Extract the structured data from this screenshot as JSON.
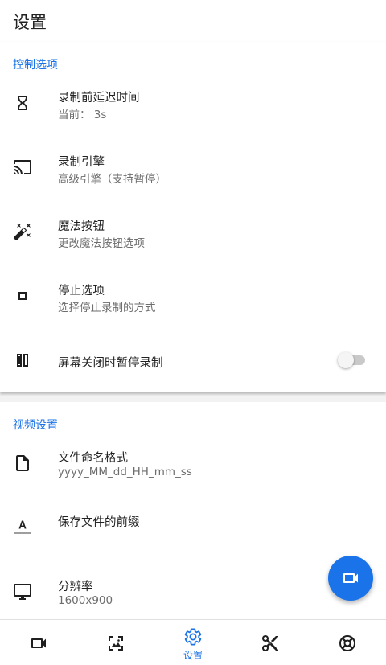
{
  "header": {
    "title": "设置"
  },
  "control_section": {
    "title": "控制选项",
    "items": [
      {
        "label": "录制前延迟时间",
        "subtitle": "当前： 3s",
        "icon": "hourglass-icon"
      },
      {
        "label": "录制引擎",
        "subtitle": "高级引擎（支持暂停）",
        "icon": "cast-icon"
      },
      {
        "label": "魔法按钮",
        "subtitle": "更改魔法按钮选项",
        "icon": "magic-wand-icon"
      },
      {
        "label": "停止选项",
        "subtitle": "选择停止录制的方式",
        "icon": "stop-icon"
      },
      {
        "label": "屏幕关闭时暂停录制",
        "icon": "pause-icon",
        "toggle_on": false
      }
    ]
  },
  "video_section": {
    "title": "视频设置",
    "items": [
      {
        "label": "文件命名格式",
        "subtitle": "yyyy_MM_dd_HH_mm_ss",
        "icon": "file-icon"
      },
      {
        "label": "保存文件的前缀",
        "icon": "text-format-icon"
      },
      {
        "label": "分辨率",
        "subtitle": "1600x900",
        "icon": "monitor-icon"
      }
    ]
  },
  "fab": {
    "icon": "videocam-icon"
  },
  "bottom_nav": {
    "items": [
      {
        "icon": "videocam-icon",
        "label": ""
      },
      {
        "icon": "screenshot-icon",
        "label": ""
      },
      {
        "icon": "settings-icon",
        "label": "设置",
        "active": true
      },
      {
        "icon": "scissors-icon",
        "label": ""
      },
      {
        "icon": "lifebuoy-icon",
        "label": ""
      }
    ]
  },
  "colors": {
    "accent": "#1a73e8",
    "primary_text": "#212121",
    "secondary_text": "#6d6d6d",
    "icon": "#1f1f1f"
  }
}
